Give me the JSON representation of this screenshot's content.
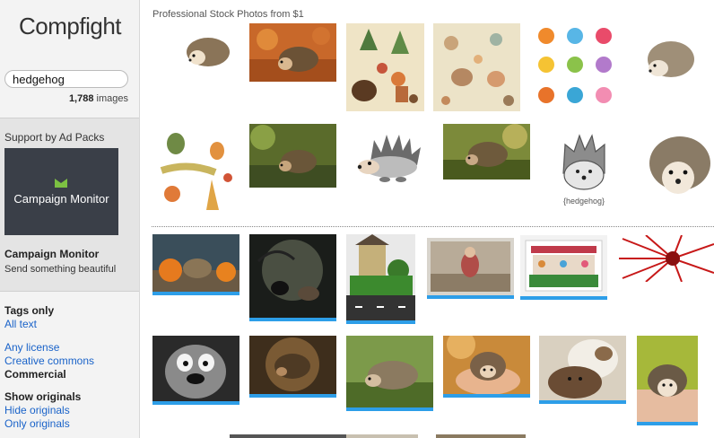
{
  "sidebar": {
    "logo": "Compfight",
    "search": {
      "value": "hedgehog"
    },
    "count": "1,788",
    "count_suffix": " images",
    "ad": {
      "header": "Support by Ad Packs",
      "brand": "Campaign Monitor",
      "title": "Campaign Monitor",
      "subtitle": "Send something beautiful"
    },
    "filters": {
      "tags_only": "Tags only",
      "all_text": "All text",
      "any_license": "Any license",
      "creative_commons": "Creative commons",
      "commercial": "Commercial",
      "show_originals": "Show originals",
      "hide_originals": "Hide originals",
      "only_originals": "Only originals"
    }
  },
  "main": {
    "promo_label": "Professional Stock Photos from $1",
    "sticker_text": "{hedgehog}"
  },
  "colors": {
    "link": "#1a63c9",
    "accent_bar": "#2d9ee8",
    "ad_bg": "#3a3f48",
    "ad_mark": "#7cc142"
  }
}
